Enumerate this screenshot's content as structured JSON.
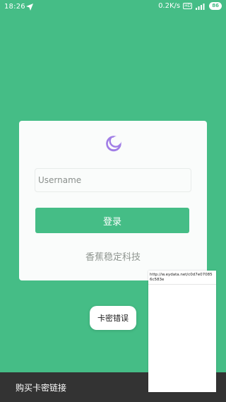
{
  "status_bar": {
    "time": "18:26",
    "network_speed": "0.2K/s",
    "hd_label": "HD",
    "battery": "86"
  },
  "login": {
    "username_placeholder": "Username",
    "login_button": "登录",
    "brand": "香蕉稳定科技"
  },
  "toast": {
    "message": "卡密错误"
  },
  "bottom_bar": {
    "label": "购买卡密链接"
  },
  "web_panel": {
    "url": "http://w.eydata.net/c0d7e070856c583e"
  },
  "colors": {
    "background": "#45bd86",
    "accent": "#45bd86",
    "logo": "#a17ee6",
    "card": "#fafcfb",
    "bottom_bar": "#333333"
  },
  "icons": {
    "status_nav": "navigation-arrow-icon",
    "signal": "signal-bars-icon",
    "logo": "moon-icon"
  }
}
